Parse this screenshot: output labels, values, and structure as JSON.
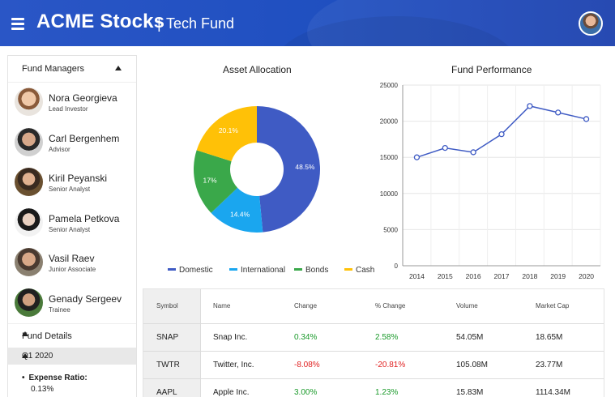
{
  "header": {
    "app_title": "ACME Stocks",
    "separator": "|",
    "subtitle": "Tech Fund",
    "gradient_colors": [
      "#2a56c6",
      "#1a3fae"
    ]
  },
  "sidebar": {
    "managers_title": "Fund Managers",
    "managers": [
      {
        "name": "Nora Georgieva",
        "role": "Lead Investor"
      },
      {
        "name": "Carl Bergenhem",
        "role": "Advisor"
      },
      {
        "name": "Kiril Peyanski",
        "role": "Senior Analyst"
      },
      {
        "name": "Pamela Petkova",
        "role": "Senior Analyst"
      },
      {
        "name": "Vasil Raev",
        "role": "Junior Associate"
      },
      {
        "name": "Genady Sergeev",
        "role": "Trainee"
      }
    ],
    "details_title": "Fund Details",
    "quarter": "Q1 2020",
    "expense_label": "Expense Ratio:",
    "expense_value": "0.13%"
  },
  "allocation": {
    "title": "Asset Allocation",
    "chart_data": {
      "type": "pie",
      "title": "Asset Allocation",
      "categories": [
        "Domestic",
        "International",
        "Bonds",
        "Cash"
      ],
      "values": [
        48.5,
        14.4,
        17,
        20.1
      ],
      "labels": [
        "48.5%",
        "14.4%",
        "17%",
        "20.1%"
      ],
      "colors": [
        "#3f5bc4",
        "#1aa6ef",
        "#3aa84a",
        "#ffc107"
      ],
      "legend": "bottom"
    }
  },
  "performance": {
    "title": "Fund Performance",
    "chart_data": {
      "type": "line",
      "title": "Fund Performance",
      "x": [
        "2014",
        "2015",
        "2016",
        "2017",
        "2018",
        "2019",
        "2020"
      ],
      "values": [
        15000,
        16300,
        15700,
        18200,
        22100,
        21200,
        20300
      ],
      "ylim": [
        0,
        25000
      ],
      "yticks": [
        "25000",
        "20000",
        "15000",
        "10000",
        "5000",
        "0"
      ],
      "grid": true,
      "color": "#3f5bc4"
    }
  },
  "grid": {
    "columns": [
      "Symbol",
      "Name",
      "Change",
      "% Change",
      "Volume",
      "Market Cap"
    ],
    "rows": [
      {
        "symbol": "SNAP",
        "name": "Snap Inc.",
        "change": "0.34%",
        "pct": "2.58%",
        "volume": "54.05M",
        "cap": "18.65M",
        "dir": "pos"
      },
      {
        "symbol": "TWTR",
        "name": "Twitter, Inc.",
        "change": "-8.08%",
        "pct": "-20.81%",
        "volume": "105.08M",
        "cap": "23.77M",
        "dir": "neg"
      },
      {
        "symbol": "AAPL",
        "name": "Apple Inc.",
        "change": "3.00%",
        "pct": "1.23%",
        "volume": "15.83M",
        "cap": "1114.34M",
        "dir": "pos"
      }
    ],
    "colors": {
      "positive": "#1a9a2a",
      "negative": "#e02020"
    }
  }
}
